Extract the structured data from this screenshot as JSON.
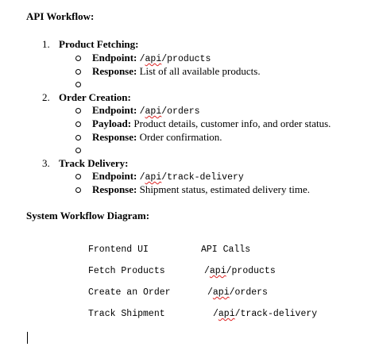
{
  "doc": {
    "heading": "API Workflow:",
    "steps": [
      {
        "num": "1.",
        "title": "Product Fetching:",
        "items": [
          {
            "label": "Endpoint:",
            "text": "/api/products"
          },
          {
            "label": "Response:",
            "text": "List of all available products."
          }
        ]
      },
      {
        "num": "2.",
        "title": "Order Creation:",
        "items": [
          {
            "label": "Endpoint:",
            "text": "/api/orders"
          },
          {
            "label": "Payload:",
            "text": "Product details, customer info, and order status."
          },
          {
            "label": "Response:",
            "text": "Order confirmation."
          }
        ]
      },
      {
        "num": "3.",
        "title": "Track Delivery:",
        "items": [
          {
            "label": "Endpoint:",
            "text": "/api/track-delivery"
          },
          {
            "label": "Response:",
            "text": "Shipment status, estimated delivery time."
          }
        ]
      }
    ],
    "diagram_heading": "System Workflow Diagram:",
    "diagram": {
      "col1_header": "Frontend UI",
      "col2_header": "API Calls",
      "rows": [
        {
          "left": "Fetch Products",
          "right": "/api/products"
        },
        {
          "left": "Create an Order",
          "right": "/api/orders"
        },
        {
          "left": "Track Shipment",
          "right": "/api/track-delivery"
        }
      ]
    }
  }
}
